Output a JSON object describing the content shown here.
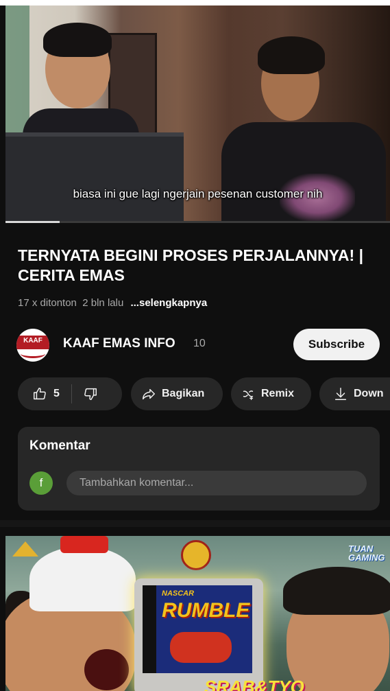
{
  "video": {
    "subtitle": "biasa ini gue lagi ngerjain pesenan customer nih",
    "progress_fraction": 0.14
  },
  "info": {
    "title": "TERNYATA BEGINI PROSES PERJALANNYA! | CERITA EMAS",
    "views": "17 x ditonton",
    "age": "2 bln lalu",
    "more_label": "...selengkapnya"
  },
  "channel": {
    "logo_text": "KAAF",
    "name": "KAAF EMAS INFO",
    "subscriber_count": "10",
    "subscribe_label": "Subscribe"
  },
  "actions": {
    "like_count": "5",
    "share_label": "Bagikan",
    "remix_label": "Remix",
    "download_label": "Down"
  },
  "comments": {
    "heading": "Komentar",
    "avatar_letter": "f",
    "placeholder": "Tambahkan komentar..."
  },
  "next_thumbnail": {
    "brand": [
      "TUAN",
      "GAMING"
    ],
    "game_top": "NASCAR",
    "game_title": "RUMBLE",
    "bottom_text": "SRAB&TYO"
  },
  "colors": {
    "background": "#0f0f0f",
    "chip": "#272727",
    "subscribe_bg": "#f1f1f1",
    "avatar": "#5a9e38",
    "secondary_text": "#aaaaaa"
  }
}
